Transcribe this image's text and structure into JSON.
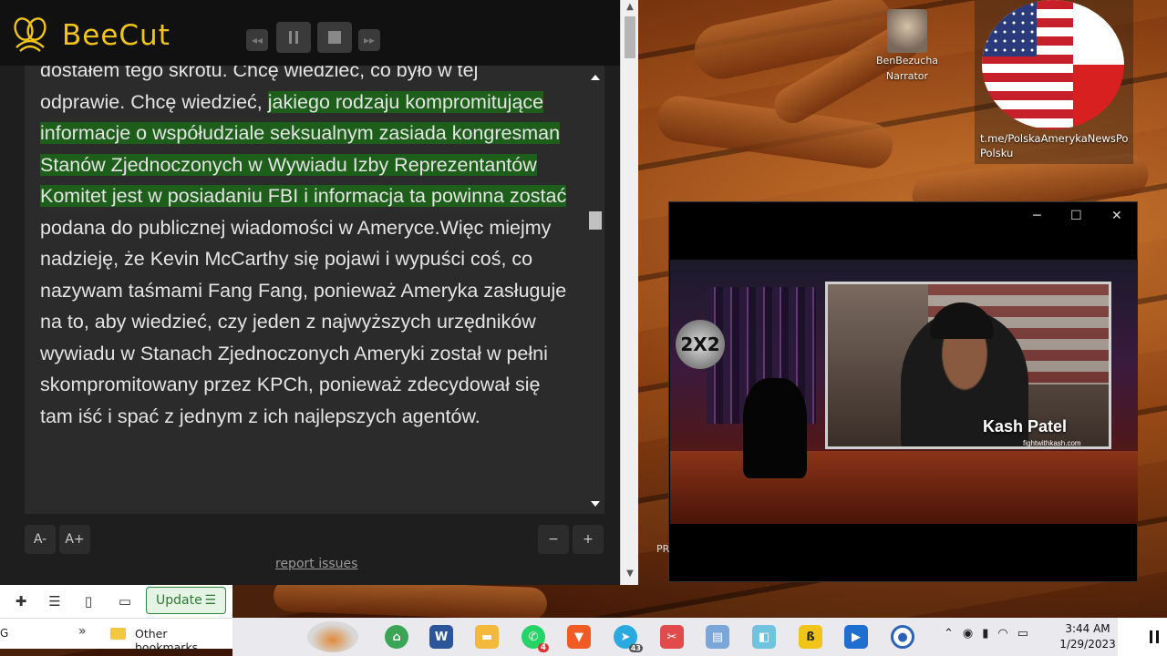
{
  "app": {
    "name": "BeeCut"
  },
  "transcript": {
    "partial_top": "dostałem tego skrótu. Chcę wiedzieć, co było w tej",
    "before_highlight": "odprawie. Chcę wiedzieć, ",
    "highlight": "jakiego rodzaju kompromitujące informacje o współudziale seksualnym zasiada kongresman Stanów Zjednoczonych w Wywiadu Izby Reprezentantów Komitet jest w posiadaniu FBI i informacja ta powinna zostać",
    "after_highlight": " podana do publicznej wiadomości w Ameryce.Więc miejmy nadzieję, że Kevin McCarthy się pojawi i wypuści coś, co nazywam taśmami Fang Fang, ponieważ Ameryka zasługuje na to, aby wiedzieć, czy jeden z najwyższych urzędników wywiadu w Stanach Zjednoczonych Ameryki został w pełni skompromitowany przez KPCh, ponieważ zdecydował się tam iść i spać z jednym z ich najlepszych agentów."
  },
  "controls": {
    "font_decrease": "A-",
    "font_increase": "A+",
    "zoom_out": "−",
    "zoom_in": "+",
    "report": "report issues"
  },
  "browser": {
    "update_label": "Update",
    "bookmarks_prefix": "G",
    "bookmarks_overflow": "»",
    "other_bookmarks": "Other bookmarks"
  },
  "overlay": {
    "narrator_name": "BenBezucha",
    "narrator_role": "Narrator",
    "channel_link": "t.me/PolskaAmerykaNewsPo Polsku"
  },
  "video": {
    "logo_text": "2X2",
    "guest_name": "Kash Patel",
    "guest_site": "fightwithkash.com",
    "partial_label": "PR"
  },
  "taskbar": {
    "time": "3:44 AM",
    "date": "1/29/2023",
    "whatsapp_badge": "4",
    "telegram_badge": "43"
  }
}
